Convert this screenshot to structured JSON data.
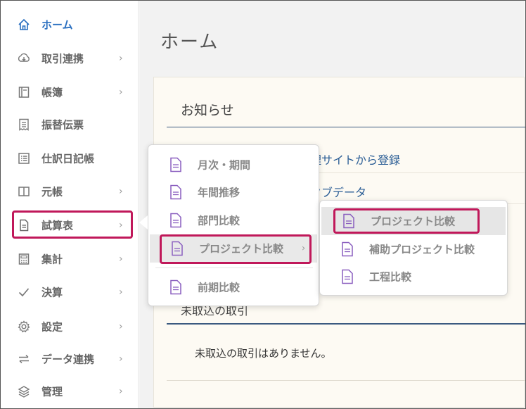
{
  "sidebar": {
    "items": [
      {
        "label": "ホーム",
        "icon": "home-icon",
        "has_chevron": false,
        "active": true
      },
      {
        "label": "取引連携",
        "icon": "cloud-download-icon",
        "has_chevron": true
      },
      {
        "label": "帳簿",
        "icon": "book-icon",
        "has_chevron": true
      },
      {
        "label": "振替伝票",
        "icon": "voucher-icon",
        "has_chevron": false
      },
      {
        "label": "仕訳日記帳",
        "icon": "list-icon",
        "has_chevron": false
      },
      {
        "label": "元帳",
        "icon": "ledger-icon",
        "has_chevron": true
      },
      {
        "label": "試算表",
        "icon": "document-icon",
        "has_chevron": true,
        "highlighted": true
      },
      {
        "label": "集計",
        "icon": "calculator-icon",
        "has_chevron": true
      },
      {
        "label": "決算",
        "icon": "check-icon",
        "has_chevron": true
      },
      {
        "label": "設定",
        "icon": "gear-icon",
        "has_chevron": true
      },
      {
        "label": "データ連携",
        "icon": "exchange-icon",
        "has_chevron": true
      },
      {
        "label": "管理",
        "icon": "layers-icon",
        "has_chevron": true
      }
    ],
    "chevron": "›"
  },
  "main": {
    "title": "ホーム",
    "notice": {
      "title": "お知らせ",
      "rows": [
        "理サイトから登録",
        "タブデータ"
      ]
    },
    "unimported": {
      "title": "未取込の取引",
      "empty_message": "未取込の取引はありません。"
    }
  },
  "submenu": {
    "items": [
      {
        "label": "月次・期間"
      },
      {
        "label": "年間推移"
      },
      {
        "label": "部門比較"
      },
      {
        "label": "プロジェクト比較",
        "has_chevron": true,
        "highlighted": true
      },
      {
        "label": "前期比較"
      }
    ]
  },
  "submenu2": {
    "items": [
      {
        "label": "プロジェクト比較",
        "highlighted": true
      },
      {
        "label": "補助プロジェクト比較"
      },
      {
        "label": "工程比較"
      }
    ]
  },
  "colors": {
    "accent_blue": "#2a6fc0",
    "highlight_magenta": "#c0185a",
    "doc_icon_purple": "#8a5fbf"
  }
}
